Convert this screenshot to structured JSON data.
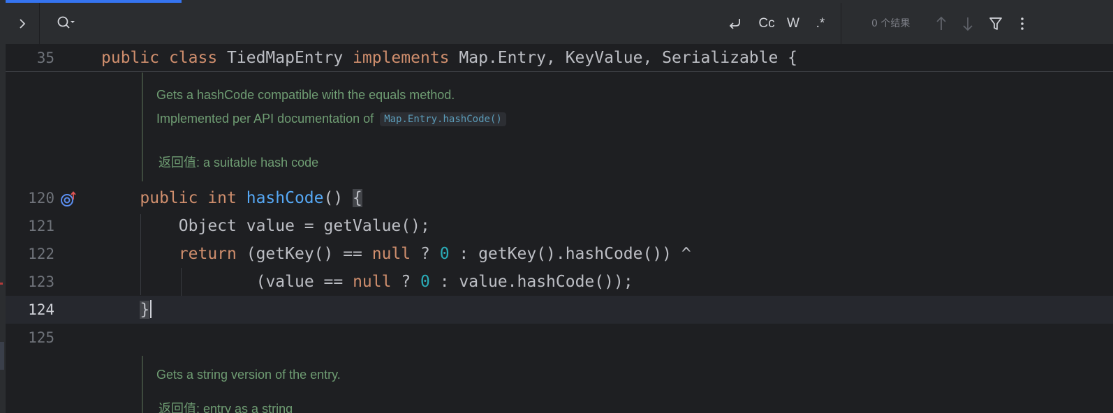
{
  "search_bar": {
    "query": "",
    "tools": {
      "wrap_label": "",
      "match_case_label": "Cc",
      "words_label": "W",
      "regex_label": ".*"
    },
    "results_text": "0 个结果"
  },
  "editor": {
    "sticky": {
      "line_number": "35",
      "tokens": [
        {
          "t": "public ",
          "c": "kw"
        },
        {
          "t": "class ",
          "c": "kw"
        },
        {
          "t": "TiedMapEntry ",
          "c": ""
        },
        {
          "t": "implements ",
          "c": "kw"
        },
        {
          "t": "Map.Entry, KeyValue, Serializable {",
          "c": ""
        }
      ]
    },
    "doc1": {
      "line1": "Gets a hashCode compatible with the equals method.",
      "line2_prefix": "Implemented per API documentation of",
      "line2_code": "Map.Entry.hashCode()",
      "returns_label": "返回值:",
      "returns_text": "a suitable hash code"
    },
    "lines": [
      {
        "num": "120",
        "indent": 2,
        "tokens": [
          {
            "t": "public ",
            "c": "kw"
          },
          {
            "t": "int ",
            "c": "kw"
          },
          {
            "t": "hashCode",
            "c": "fn"
          },
          {
            "t": "() ",
            "c": ""
          },
          {
            "t": "{",
            "c": "brace"
          }
        ]
      },
      {
        "num": "121",
        "indent": 4,
        "tokens": [
          {
            "t": "Object value = getValue();",
            "c": ""
          }
        ]
      },
      {
        "num": "122",
        "indent": 4,
        "tokens": [
          {
            "t": "return ",
            "c": "kw"
          },
          {
            "t": "(getKey() == ",
            "c": ""
          },
          {
            "t": "null",
            "c": "kw"
          },
          {
            "t": " ? ",
            "c": ""
          },
          {
            "t": "0",
            "c": "num"
          },
          {
            "t": " : getKey().hashCode()) ^",
            "c": ""
          }
        ]
      },
      {
        "num": "123",
        "indent": 8,
        "tokens": [
          {
            "t": "(value == ",
            "c": ""
          },
          {
            "t": "null",
            "c": "kw"
          },
          {
            "t": " ? ",
            "c": ""
          },
          {
            "t": "0",
            "c": "num"
          },
          {
            "t": " : value.hashCode());",
            "c": ""
          }
        ]
      },
      {
        "num": "124",
        "indent": 2,
        "tokens": [
          {
            "t": "}",
            "c": "caretbrace"
          }
        ]
      },
      {
        "num": "125",
        "indent": 0,
        "tokens": []
      }
    ],
    "doc2": {
      "line1": "Gets a string version of the entry.",
      "returns_label": "返回值:",
      "returns_text": "entry as a string"
    }
  },
  "colors": {
    "background": "#1e1f22",
    "keyword": "#cf8e6d",
    "function": "#56a8f5",
    "number": "#2aacb8",
    "doc_text": "#6f9d73",
    "accent": "#3574f0"
  },
  "icons": {
    "expand": "chevron-right-icon",
    "search": "search-history-icon",
    "wrap": "wrap-icon",
    "up": "arrow-up-icon",
    "down": "arrow-down-icon",
    "filter": "filter-icon",
    "more": "more-vertical-icon",
    "gutter": "implements-method-icon"
  }
}
